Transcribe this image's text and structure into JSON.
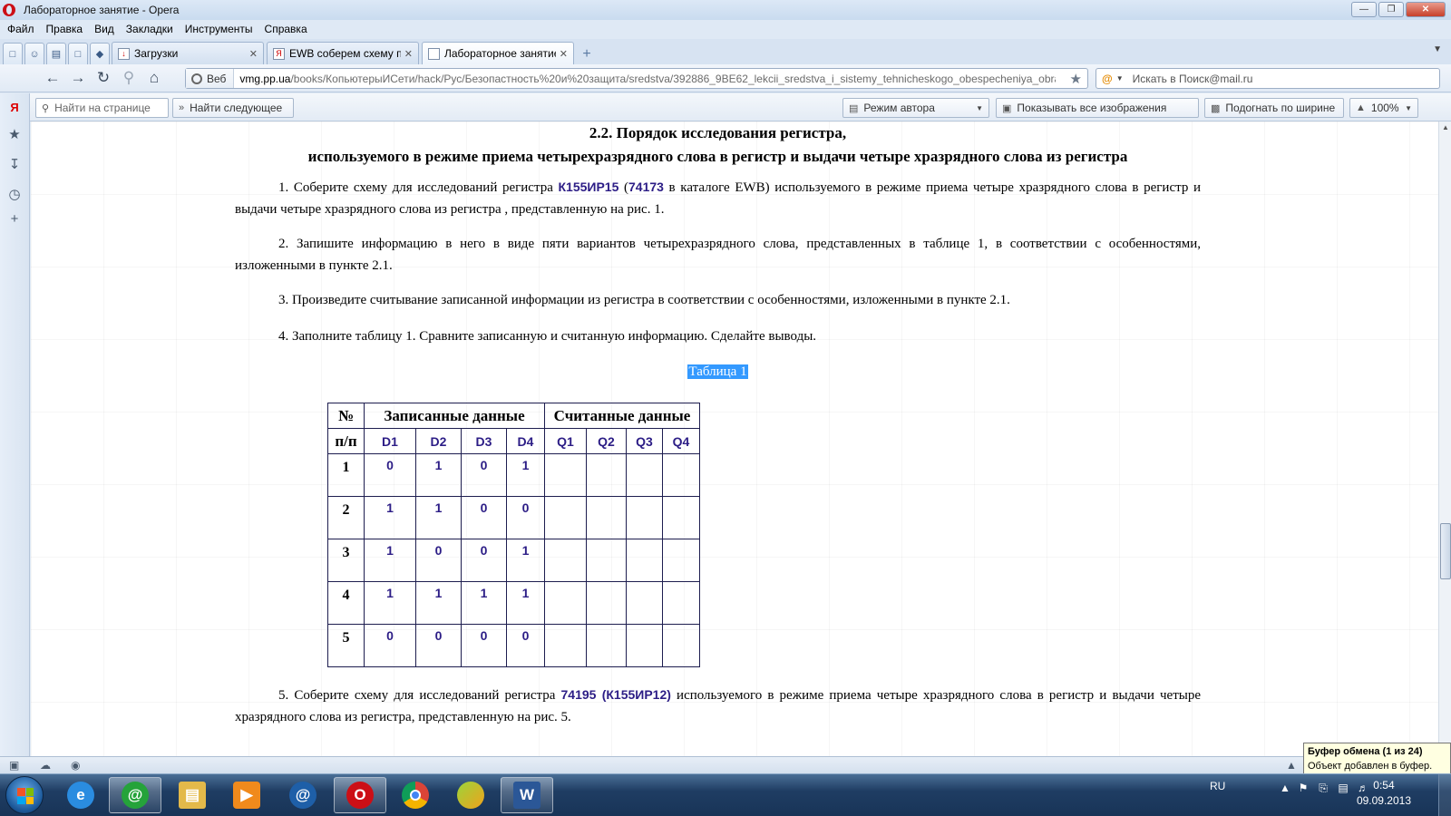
{
  "window": {
    "title": "Лабораторное занятие - Opera"
  },
  "menu": [
    "Файл",
    "Правка",
    "Вид",
    "Закладки",
    "Инструменты",
    "Справка"
  ],
  "tabs": [
    {
      "label": "Загрузки",
      "icon": "downloads-icon"
    },
    {
      "label": "EWB соберем схему п...",
      "icon": "yandex-icon"
    },
    {
      "label": "Лабораторное занятие",
      "icon": "page-icon"
    }
  ],
  "address": {
    "badge": "Веб",
    "host": "vmg.pp.ua",
    "path": "/books/КопьютерыИСети/hack/Рус/Безопастность%20и%20защита/sredstva/392886_9BE62_lekcii_sredstva_i_sistemy_tehnicheskogo_obespecheniya_obrabo/C",
    "search_placeholder": "Искать в Поиск@mail.ru"
  },
  "findbar": {
    "find_placeholder": "Найти на странице",
    "find_next": "Найти следующее",
    "author_mode": "Режим автора",
    "show_images": "Показывать все изображения",
    "fit_width": "Подогнать по ширине",
    "zoom": "100%"
  },
  "doc": {
    "heading1": "2.2. Порядок исследования регистра,",
    "heading2": "используемого в режиме приема четырехразрядного слова в регистр и выдачи четыре хразрядного слова из регистра",
    "p1": {
      "a": "1.  Соберите схему для исследований регистра ",
      "b": "К155ИР15",
      "c": " (",
      "d": "74173",
      "e": " в каталоге EWB) используемого в режиме приема четыре хразрядного слова в регистр и выдачи четыре хразрядного слова из регистра , представленную на рис. 1."
    },
    "p2": "2. Запишите информацию в него в виде пяти вариантов четырехразрядного слова, представленных в таблице 1, в соответствии с особенностями, изложенными в пункте 2.1.",
    "p3": "3.  Произведите считывание записанной информации из регистра в соответствии с особенностями, изложенными в пункте 2.1.",
    "p4": "4. Заполните таблицу 1. Сравните записанную и считанную информацию. Сделайте выводы.",
    "caption": "Таблица 1",
    "p5": {
      "a": "5.  Соберите схему для исследований регистра ",
      "b": "74195 (К155ИР12)",
      "c": " используемого в режиме приема четыре хразрядного слова в регистр и выдачи четыре хразрядного слова из регистра, представленную на рис. 5."
    }
  },
  "table": {
    "h_num_1": "№",
    "h_num_2": "п/п",
    "h_written": "Записанные данные",
    "h_read": "Считанные данные",
    "cols_d": [
      "D1",
      "D2",
      "D3",
      "D4"
    ],
    "cols_q": [
      "Q1",
      "Q2",
      "Q3",
      "Q4"
    ],
    "rows": [
      {
        "n": "1",
        "d": [
          "0",
          "1",
          "0",
          "1"
        ],
        "q": [
          "",
          "",
          "",
          ""
        ]
      },
      {
        "n": "2",
        "d": [
          "1",
          "1",
          "0",
          "0"
        ],
        "q": [
          "",
          "",
          "",
          ""
        ]
      },
      {
        "n": "3",
        "d": [
          "1",
          "0",
          "0",
          "1"
        ],
        "q": [
          "",
          "",
          "",
          ""
        ]
      },
      {
        "n": "4",
        "d": [
          "1",
          "1",
          "1",
          "1"
        ],
        "q": [
          "",
          "",
          "",
          ""
        ]
      },
      {
        "n": "5",
        "d": [
          "0",
          "0",
          "0",
          "0"
        ],
        "q": [
          "",
          "",
          "",
          ""
        ]
      }
    ]
  },
  "notification": {
    "title": "Буфер обмена (1 из 24)",
    "text": "Объект добавлен в буфер."
  },
  "tray": {
    "lang": "RU",
    "time": "0:54",
    "date": "09.09.2013"
  },
  "colors": {
    "accent_text": "#2c1d86",
    "selection": "#3399ff"
  }
}
